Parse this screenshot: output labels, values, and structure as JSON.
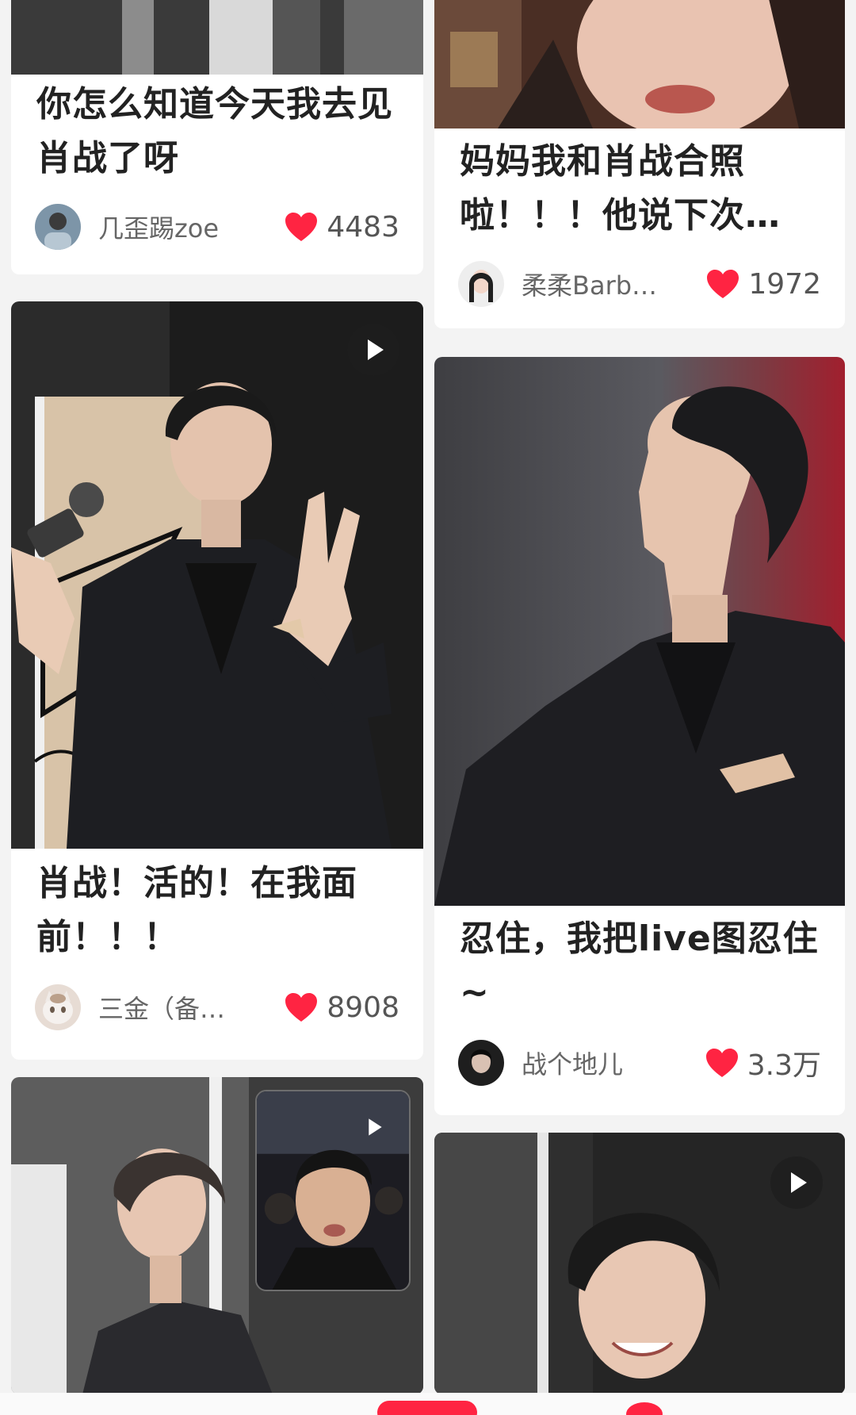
{
  "feed": {
    "cards": [
      {
        "title": "你怎么知道今天我去见肖战了呀",
        "author": "几歪踢zoe",
        "likes": "4483"
      },
      {
        "title": "妈妈我和肖战合照啦！！！他说下次…",
        "author": "柔柔Barb…",
        "likes": "1972"
      },
      {
        "title": "肖战！活的！在我面前！！！",
        "author": "三金（备…",
        "likes": "8908"
      },
      {
        "title": "忍住，我把live图忍住~",
        "author": "战个地儿",
        "likes": "3.3万"
      }
    ]
  },
  "icons": {
    "like": "heart-icon",
    "video": "play-icon"
  },
  "colors": {
    "accent": "#ff2442",
    "background": "#f3f3f3",
    "card": "#ffffff"
  }
}
